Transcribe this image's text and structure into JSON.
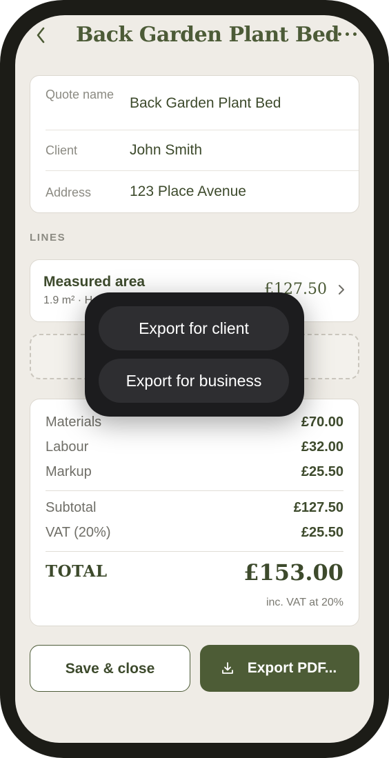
{
  "header": {
    "title": "Back Garden Plant Bed",
    "back_icon": "chevron-left-icon",
    "more_icon": "ellipsis-icon"
  },
  "details": {
    "quote_name_label": "Quote name",
    "quote_name_value": "Back Garden Plant Bed",
    "client_label": "Client",
    "client_value": "John Smith",
    "address_label": "Address",
    "address_value": "123 Place Avenue"
  },
  "lines": {
    "section_label": "LINES",
    "items": [
      {
        "title": "Measured area",
        "subtitle": "1.9 m² · H",
        "price": "£127.50"
      }
    ]
  },
  "totals": {
    "materials_label": "Materials",
    "materials_value": "£70.00",
    "labour_label": "Labour",
    "labour_value": "£32.00",
    "markup_label": "Markup",
    "markup_value": "£25.50",
    "subtotal_label": "Subtotal",
    "subtotal_value": "£127.50",
    "vat_label": "VAT (20%)",
    "vat_value": "£25.50",
    "total_label": "TOTAL",
    "total_value": "£153.00",
    "vat_note": "inc. VAT at 20%"
  },
  "actions": {
    "save_label": "Save & close",
    "export_label": "Export PDF...",
    "export_icon": "download-icon"
  },
  "export_menu": {
    "client_option": "Export for client",
    "business_option": "Export for business"
  },
  "colors": {
    "accent": "#4d5c36",
    "background": "#efece6",
    "menu": "#1c1c1e"
  }
}
